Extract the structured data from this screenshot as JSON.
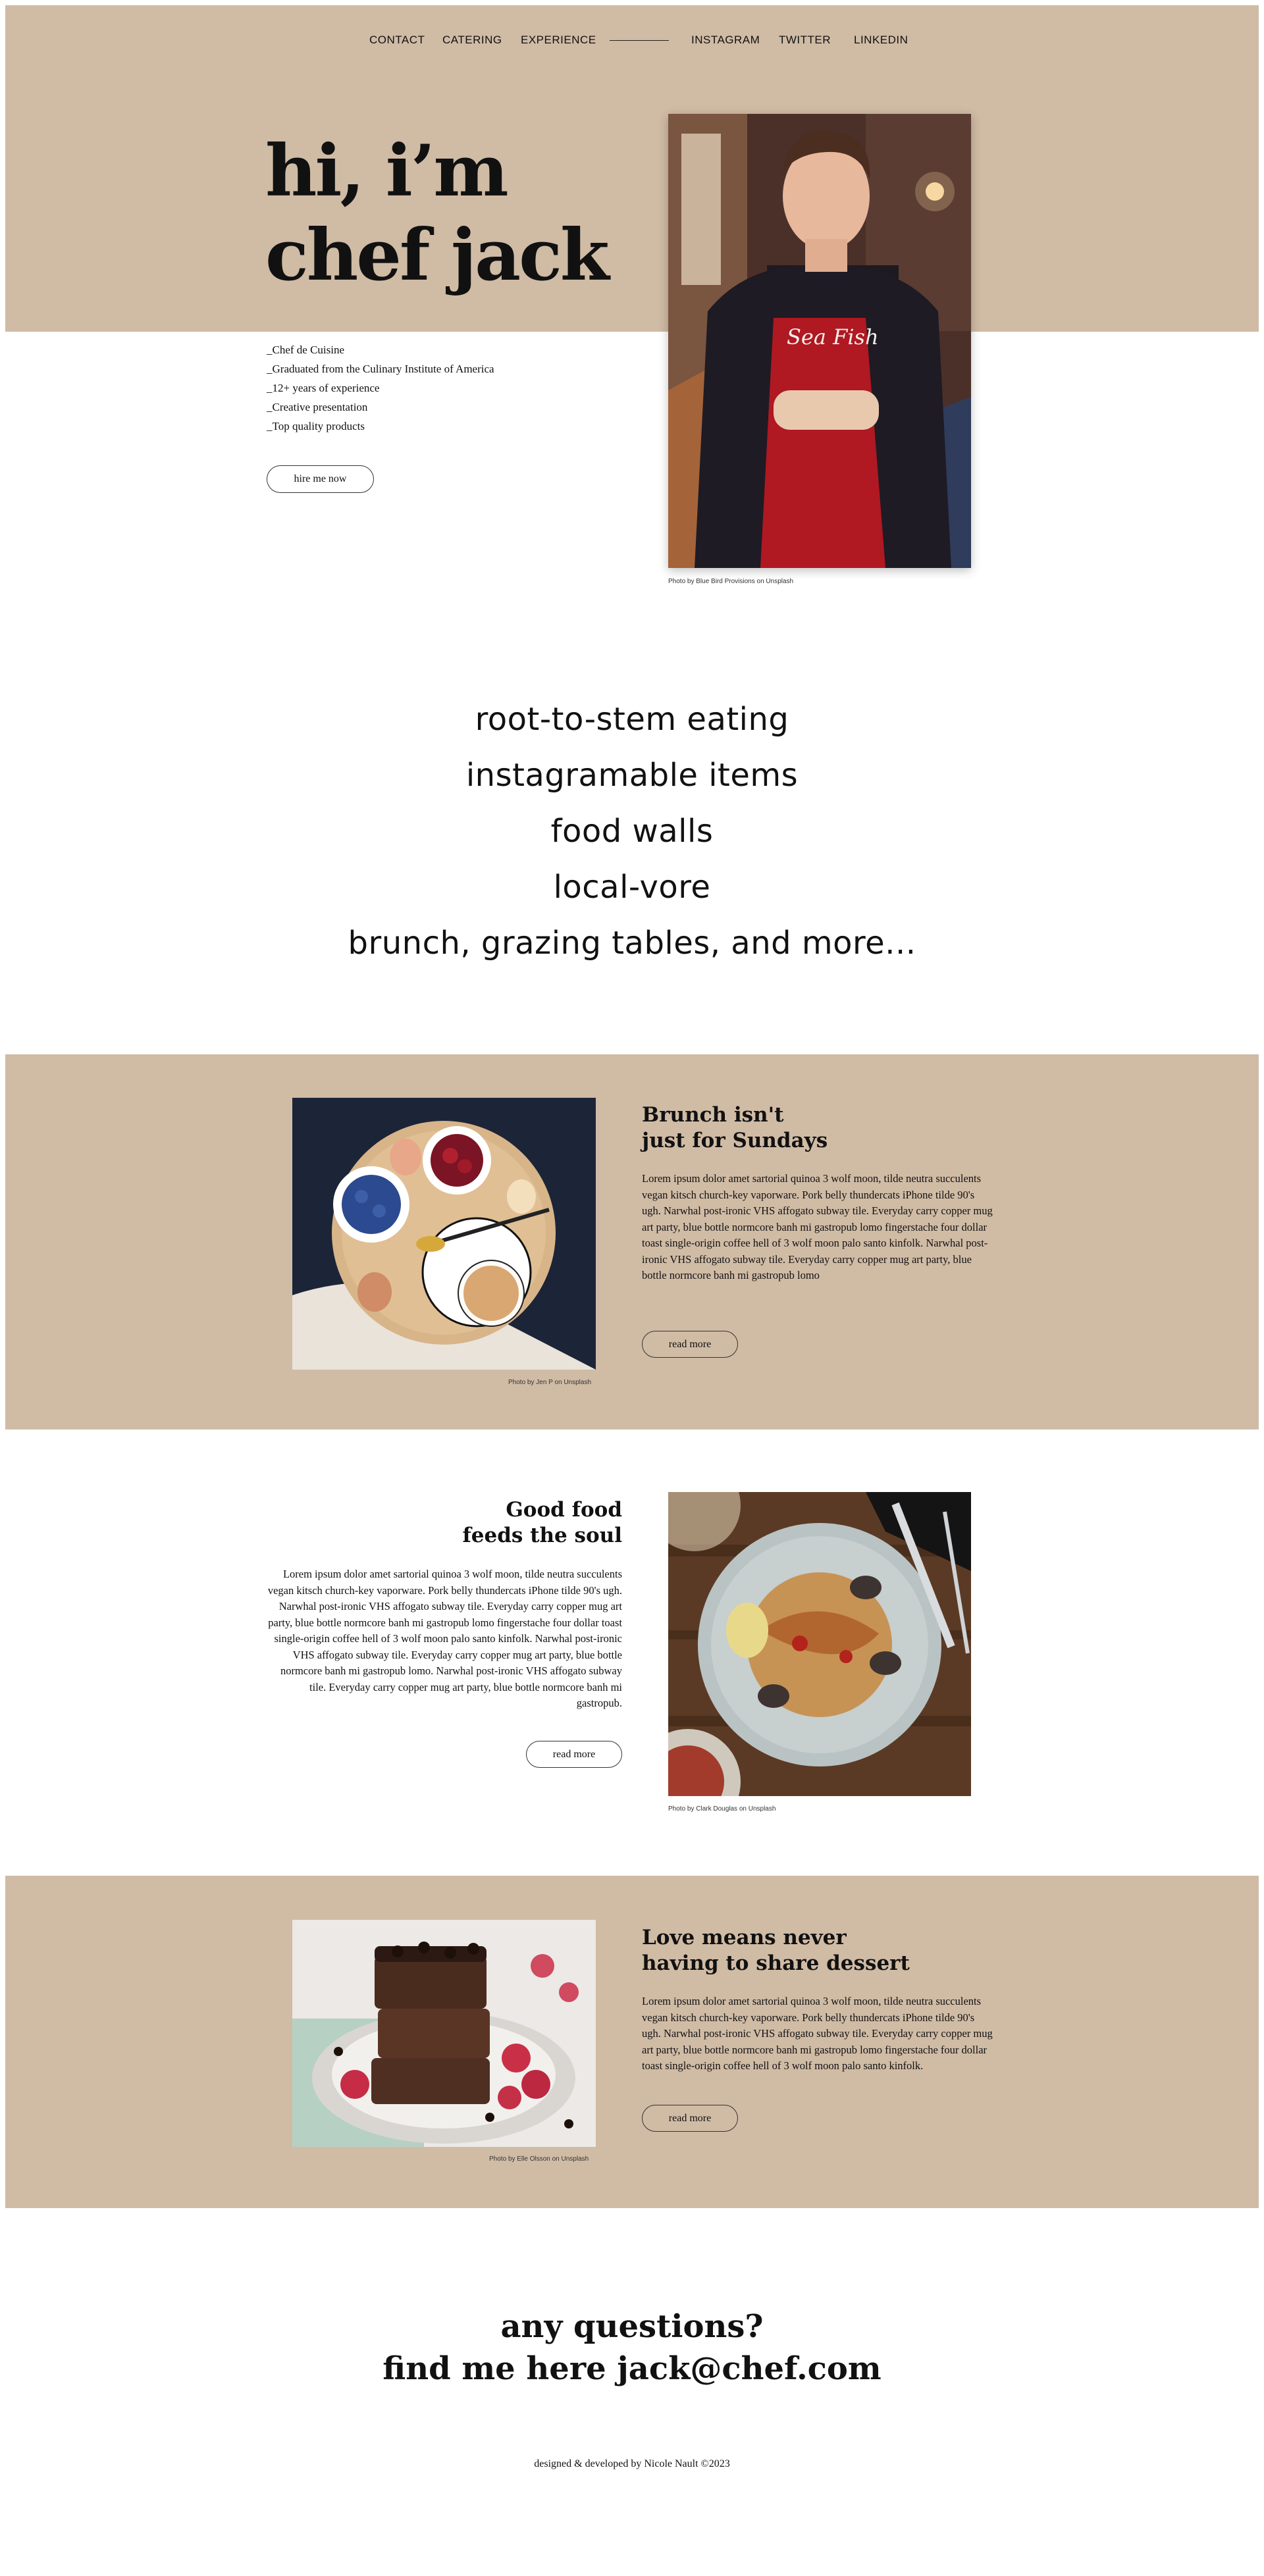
{
  "nav": {
    "left": [
      "CONTACT",
      "CATERING",
      "EXPERIENCE"
    ],
    "right": [
      "INSTAGRAM",
      "TWITTER",
      "LINKEDIN"
    ]
  },
  "hero": {
    "title_line1": "hi, i’m",
    "title_line2": "chef jack",
    "facts": [
      "_Chef de Cuisine",
      "_Graduated from the Culinary Institute of America",
      "_12+ years of experience",
      "_Creative presentation",
      "_Top quality products"
    ],
    "button": "hire me now",
    "photo_credit": "Photo by Blue Bird Provisions on Unsplash"
  },
  "specialties": [
    "root-to-stem eating",
    "instagramable items",
    "food walls",
    "local-vore",
    "brunch, grazing tables, and more..."
  ],
  "cards": [
    {
      "title_line1": "Brunch isn't",
      "title_line2": "just for Sundays",
      "body": "Lorem ipsum dolor amet sartorial quinoa 3 wolf moon, tilde neutra succulents vegan kitsch church-key vaporware. Pork belly thundercats iPhone tilde 90's ugh. Narwhal post-ironic VHS affogato subway tile. Everyday carry copper mug art party, blue bottle normcore banh mi gastropub lomo fingerstache four dollar toast single-origin coffee hell of 3 wolf moon palo santo kinfolk. Narwhal post-ironic VHS affogato subway tile. Everyday carry copper mug art party, blue bottle normcore banh mi gastropub lomo",
      "button": "read more",
      "photo_credit": "Photo by Jen P on Unsplash"
    },
    {
      "title_line1": "Good food",
      "title_line2": "feeds the soul",
      "body": "Lorem ipsum dolor amet sartorial quinoa 3 wolf moon, tilde neutra succulents vegan kitsch church-key vaporware. Pork belly thundercats iPhone tilde 90's ugh. Narwhal post-ironic VHS affogato subway tile. Everyday carry copper mug art party, blue bottle normcore banh mi gastropub lomo fingerstache four dollar toast single-origin coffee hell of 3 wolf moon palo santo kinfolk. Narwhal post-ironic VHS affogato subway tile. Everyday carry copper mug art party, blue bottle normcore banh mi gastropub lomo. Narwhal post-ironic VHS affogato subway tile. Everyday carry copper mug art party, blue bottle normcore banh mi gastropub.",
      "button": "read more",
      "photo_credit": "Photo by Clark Douglas on Unsplash"
    },
    {
      "title_line1": "Love means never",
      "title_line2": "having to share dessert",
      "body": "Lorem ipsum dolor amet sartorial quinoa 3 wolf moon, tilde neutra succulents vegan kitsch church-key vaporware. Pork belly thundercats iPhone tilde 90's ugh. Narwhal post-ironic VHS affogato subway tile. Everyday carry copper mug art party, blue bottle normcore banh mi gastropub lomo fingerstache four dollar toast single-origin coffee hell of 3 wolf moon palo santo kinfolk.",
      "button": "read more",
      "photo_credit": "Photo by Elle Olsson on Unsplash"
    }
  ],
  "contact": {
    "line1": "any questions?",
    "line2": "find me here jack@chef.com"
  },
  "footer": "designed & developed by Nicole Nault ©2023",
  "colors": {
    "band": "#d0bba5",
    "text": "#111111"
  }
}
